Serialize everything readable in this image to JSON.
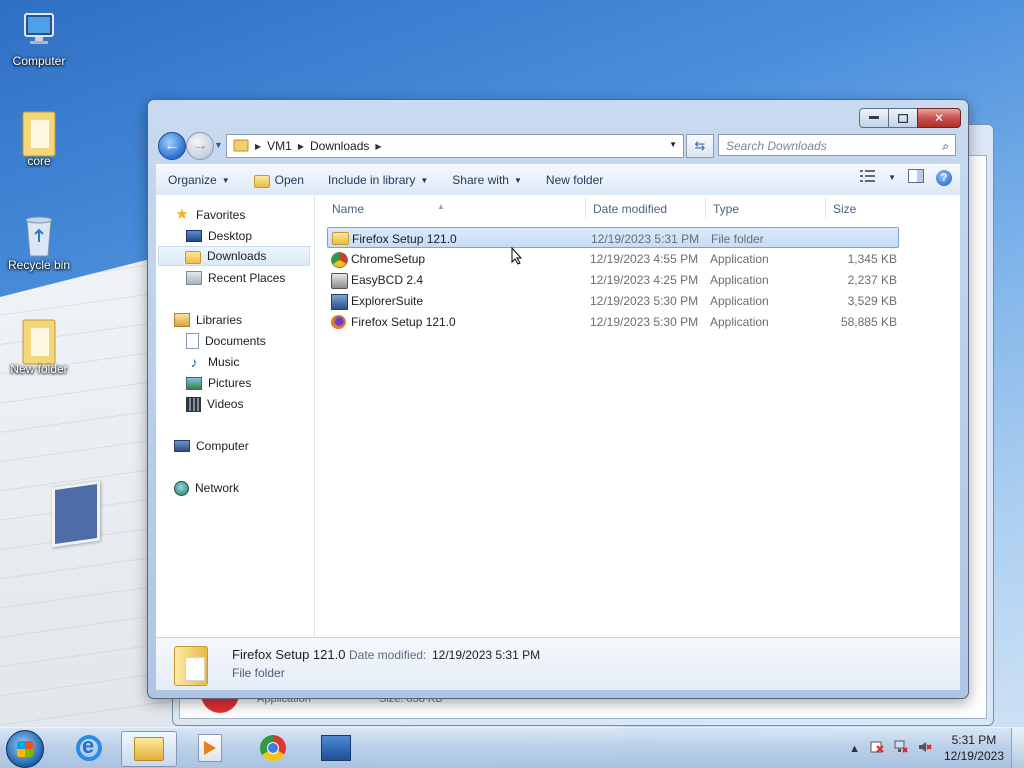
{
  "desktop": {
    "icons": [
      {
        "label": "Computer"
      },
      {
        "label": "core"
      },
      {
        "label": "Recycle bin"
      },
      {
        "label": "New folder"
      }
    ]
  },
  "background_window": {
    "status_type": "Application",
    "status_size": "Size: 838 KB"
  },
  "window": {
    "address": {
      "segments": [
        "VM1",
        "Downloads"
      ]
    },
    "search": {
      "placeholder": "Search Downloads"
    },
    "toolbar": {
      "organize": "Organize",
      "open": "Open",
      "include": "Include in library",
      "share": "Share with",
      "new_folder": "New folder"
    },
    "nav": {
      "favorites": "Favorites",
      "desktop": "Desktop",
      "downloads": "Downloads",
      "recent": "Recent Places",
      "libraries": "Libraries",
      "documents": "Documents",
      "music": "Music",
      "pictures": "Pictures",
      "videos": "Videos",
      "computer": "Computer",
      "network": "Network"
    },
    "columns": {
      "name": "Name",
      "date": "Date modified",
      "type": "Type",
      "size": "Size"
    },
    "files": [
      {
        "name": "Firefox Setup 121.0",
        "date": "12/19/2023 5:31 PM",
        "type": "File folder",
        "size": "",
        "icon": "folder-icon"
      },
      {
        "name": "ChromeSetup",
        "date": "12/19/2023 4:55 PM",
        "type": "Application",
        "size": "1,345 KB",
        "icon": "chrome-icon"
      },
      {
        "name": "EasyBCD 2.4",
        "date": "12/19/2023 4:25 PM",
        "type": "Application",
        "size": "2,237 KB",
        "icon": "easybcd-icon"
      },
      {
        "name": "ExplorerSuite",
        "date": "12/19/2023 5:30 PM",
        "type": "Application",
        "size": "3,529 KB",
        "icon": "explorersuite-icon"
      },
      {
        "name": "Firefox Setup 121.0",
        "date": "12/19/2023 5:30 PM",
        "type": "Application",
        "size": "58,885 KB",
        "icon": "firefox-icon"
      }
    ],
    "details": {
      "name": "Firefox Setup 121.0",
      "modified_label": "Date modified:",
      "modified_value": "12/19/2023 5:31 PM",
      "type": "File folder"
    }
  },
  "taskbar": {
    "time": "5:31 PM",
    "date": "12/19/2023"
  }
}
